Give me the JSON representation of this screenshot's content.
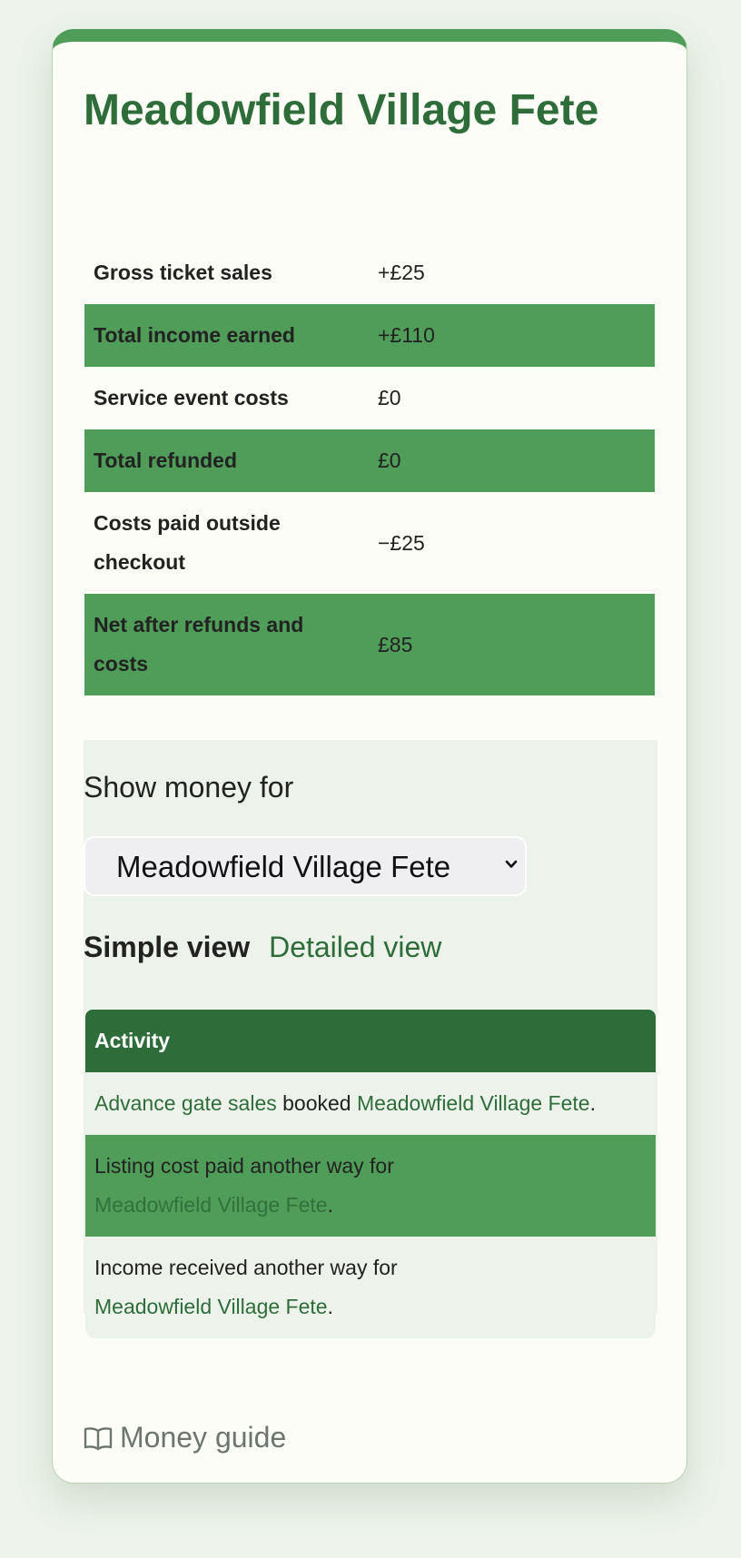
{
  "page": {
    "title": "Meadowfield Village Fete"
  },
  "summary": {
    "rows": [
      {
        "label": "Gross ticket sales",
        "value": "+£25"
      },
      {
        "label": "Total income earned",
        "value": "+£110"
      },
      {
        "label": "Service event costs",
        "value": "£0"
      },
      {
        "label": "Total refunded",
        "value": "£0"
      },
      {
        "label": "Costs paid outside checkout",
        "value": "−£25"
      },
      {
        "label": "Net after refunds and costs",
        "value": "£85"
      }
    ]
  },
  "filter": {
    "label": "Show money for",
    "selected": "Meadowfield Village Fete",
    "chevron_icon": "chevron-down-icon"
  },
  "views": {
    "simple": "Simple view",
    "detailed": "Detailed view"
  },
  "activity": {
    "header": "Activity",
    "row1": {
      "link1": "Advance gate sales",
      "text": " booked ",
      "link2": "Meadowfield Village Fete",
      "end": "."
    },
    "row2": {
      "text": "Listing cost paid another way for",
      "link": "Meadowfield Village Fete",
      "end": "."
    },
    "row3": {
      "text": "Income received another way for",
      "link": "Meadowfield Village Fete",
      "end": "."
    }
  },
  "footer": {
    "guide_label": "Money guide",
    "guide_icon": "book-icon"
  },
  "colors": {
    "brand_green": "#2e6d3a",
    "accent_green": "#4f9d58",
    "background": "#edf3ea"
  }
}
